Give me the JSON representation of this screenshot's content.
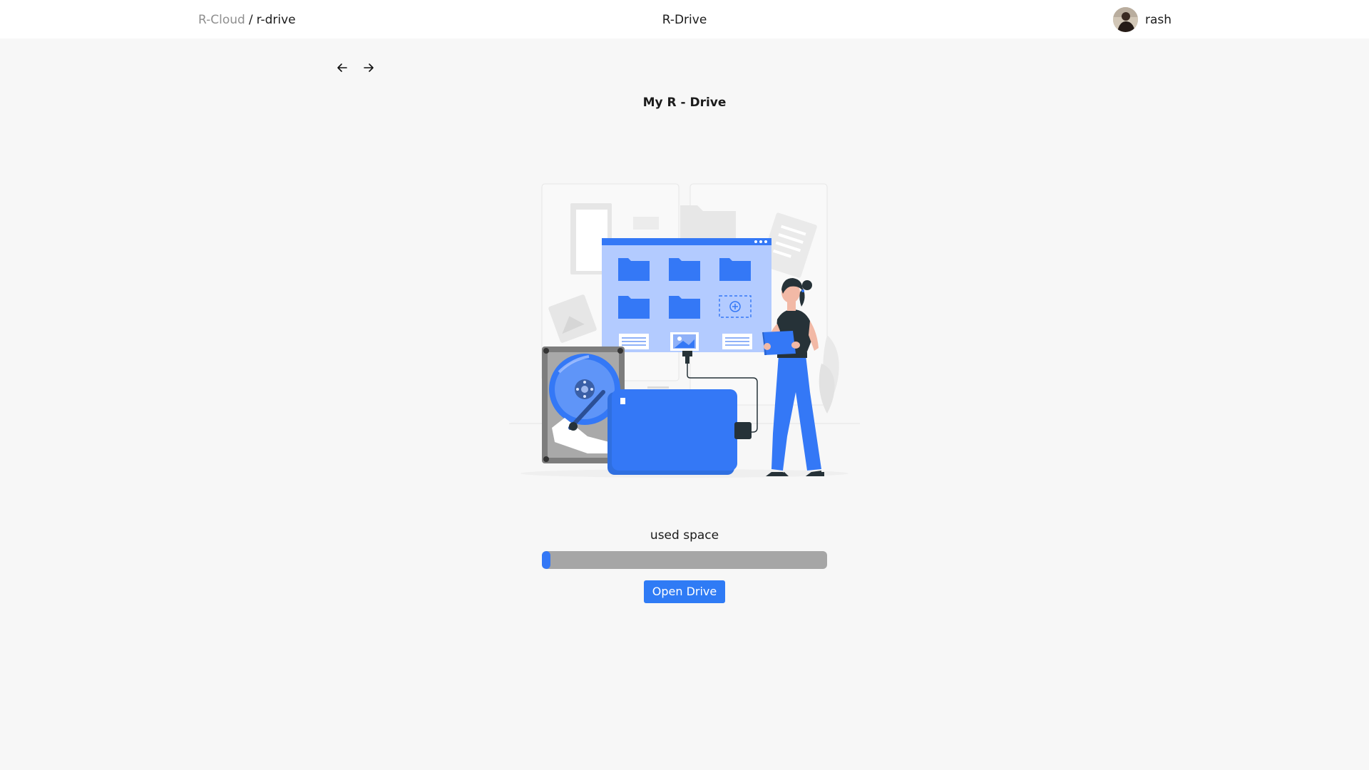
{
  "header": {
    "breadcrumb": {
      "root": "R-Cloud",
      "separator": "/",
      "current": "r-drive"
    },
    "app_title": "R-Drive",
    "user": {
      "name": "rash",
      "avatar_icon": "user-avatar"
    }
  },
  "navigation": {
    "back_icon": "arrow-left-icon",
    "forward_icon": "arrow-right-icon"
  },
  "main": {
    "title": "My R - Drive",
    "illustration": "drive-illustration",
    "usage": {
      "label": "used space",
      "fraction": 0.03
    },
    "open_button": "Open Drive"
  },
  "colors": {
    "accent": "#2f7bf5",
    "progress_track": "#a6a6a6",
    "background": "#f7f7f7",
    "header_bg": "#ffffff"
  }
}
